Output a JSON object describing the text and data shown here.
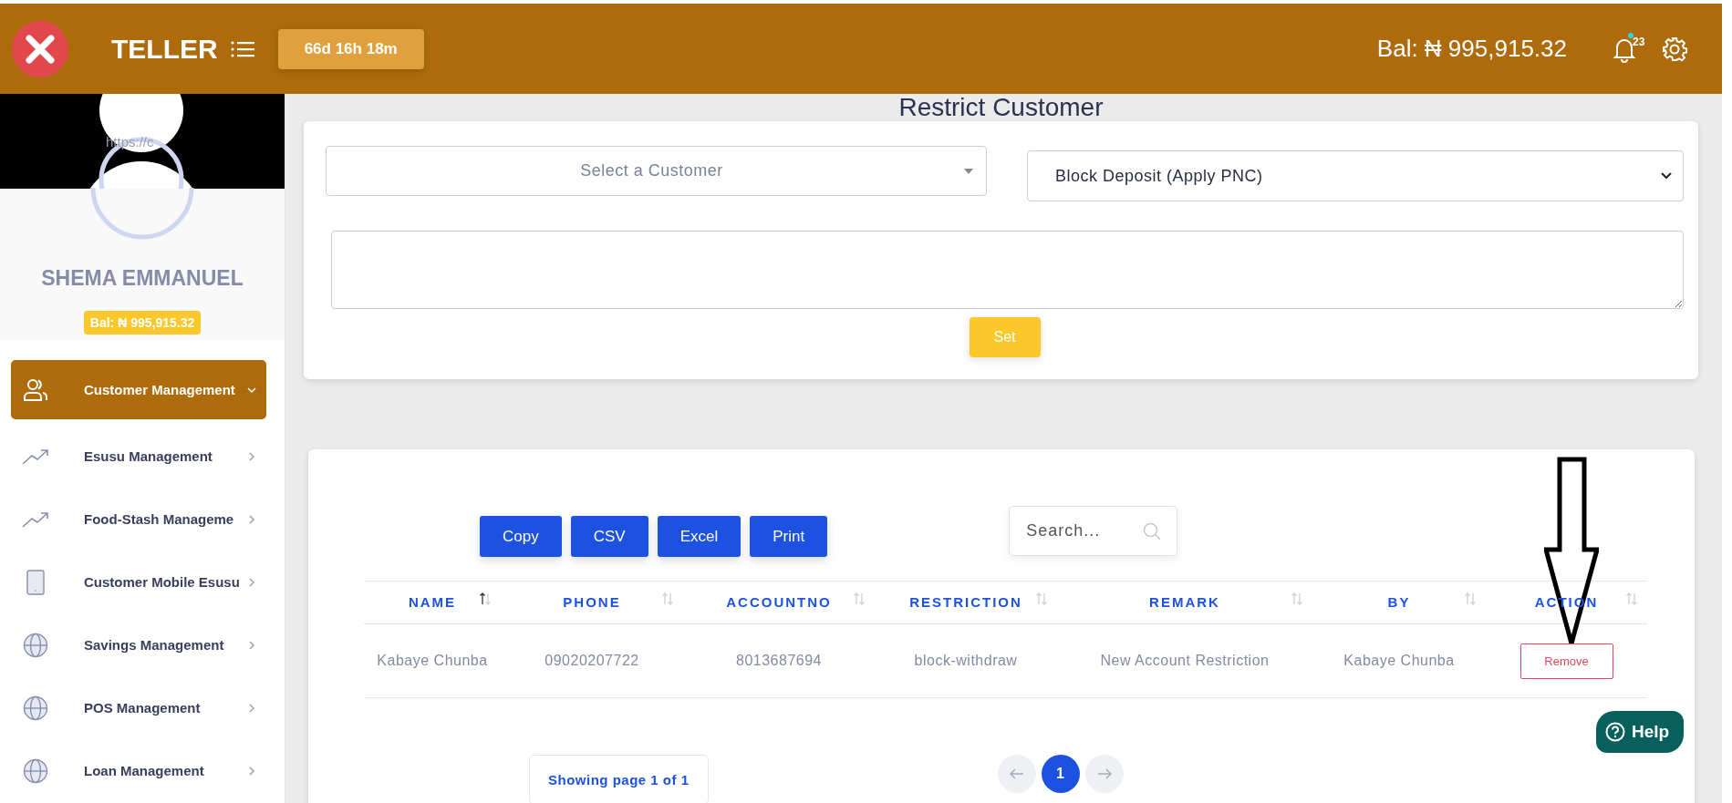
{
  "topbar": {
    "title": "TELLER",
    "timer": "66d 16h 18m",
    "balance": "Bal: ₦ 995,915.32",
    "notification_count": "23"
  },
  "sidebar": {
    "avatar_alt": "https://c",
    "user_name": "SHEMA EMMANUEL",
    "balance_badge": "Bal: ₦ 995,915.32",
    "items": [
      {
        "label": "Customer Management",
        "selected": true,
        "expanded": true
      },
      {
        "label": "Esusu Management",
        "selected": false,
        "expanded": false
      },
      {
        "label": "Food-Stash Manageme",
        "selected": false,
        "expanded": false
      },
      {
        "label": "Customer Mobile Esusu",
        "selected": false,
        "expanded": false
      },
      {
        "label": "Savings Management",
        "selected": false,
        "expanded": false
      },
      {
        "label": "POS Management",
        "selected": false,
        "expanded": false
      },
      {
        "label": "Loan Management",
        "selected": false,
        "expanded": false
      }
    ]
  },
  "page_title": "Restrict Customer",
  "form": {
    "customer_select": {
      "placeholder": "Select a Customer"
    },
    "restriction_select": {
      "value": "Block Deposit (Apply PNC)"
    },
    "set_button": "Set"
  },
  "table": {
    "export_buttons": [
      "Copy",
      "CSV",
      "Excel",
      "Print"
    ],
    "search": {
      "placeholder": "Search..."
    },
    "columns": [
      {
        "label": "NAME",
        "sorted": true
      },
      {
        "label": "PHONE",
        "sorted": false
      },
      {
        "label": "ACCOUNTNO",
        "sorted": false
      },
      {
        "label": "RESTRICTION",
        "sorted": false
      },
      {
        "label": "REMARK",
        "sorted": false
      },
      {
        "label": "BY",
        "sorted": false
      },
      {
        "label": "ACTION",
        "sorted": false
      }
    ],
    "rows": [
      {
        "cells": [
          "Kabaye Chunba",
          "09020207722",
          "8013687694",
          "block-withdraw",
          "New Account Restriction",
          "Kabaye Chunba"
        ],
        "action": "Remove"
      }
    ]
  },
  "pagination": {
    "info": "Showing page 1 of 1",
    "pages": [
      {
        "label": "1",
        "selected": true
      }
    ]
  },
  "help_button": "Help"
}
